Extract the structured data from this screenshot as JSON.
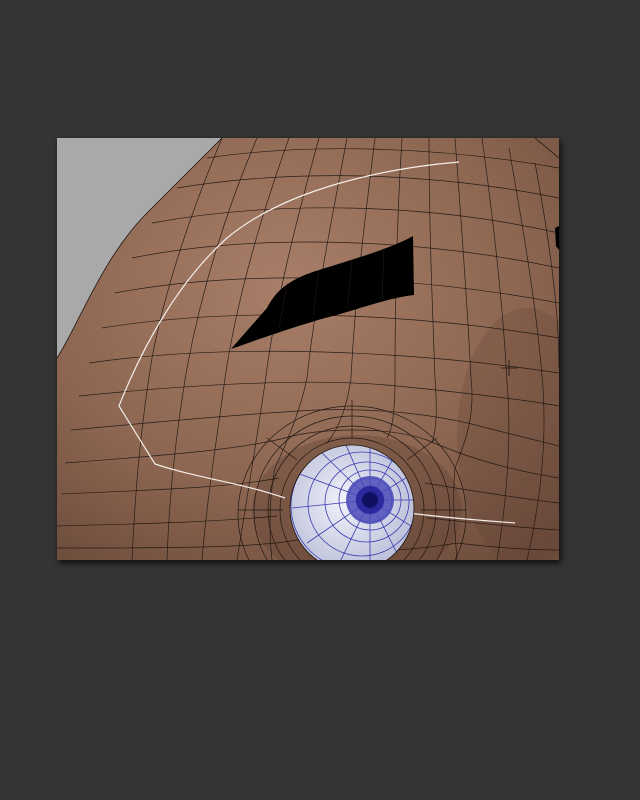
{
  "viewport": {
    "background_color": "#a9a9a9",
    "mesh_color": "#8a6350",
    "mesh_highlight": "#b08a74",
    "wire_color": "#1e1410",
    "eye_white": "#dde0ee",
    "eye_wire": "#3b3bb0",
    "iris_color": "#2a2a9e",
    "pupil_color": "#101060",
    "hole_color": "#000000",
    "curve_color": "#f2ede8"
  },
  "canvas": {
    "background": "#343434"
  }
}
